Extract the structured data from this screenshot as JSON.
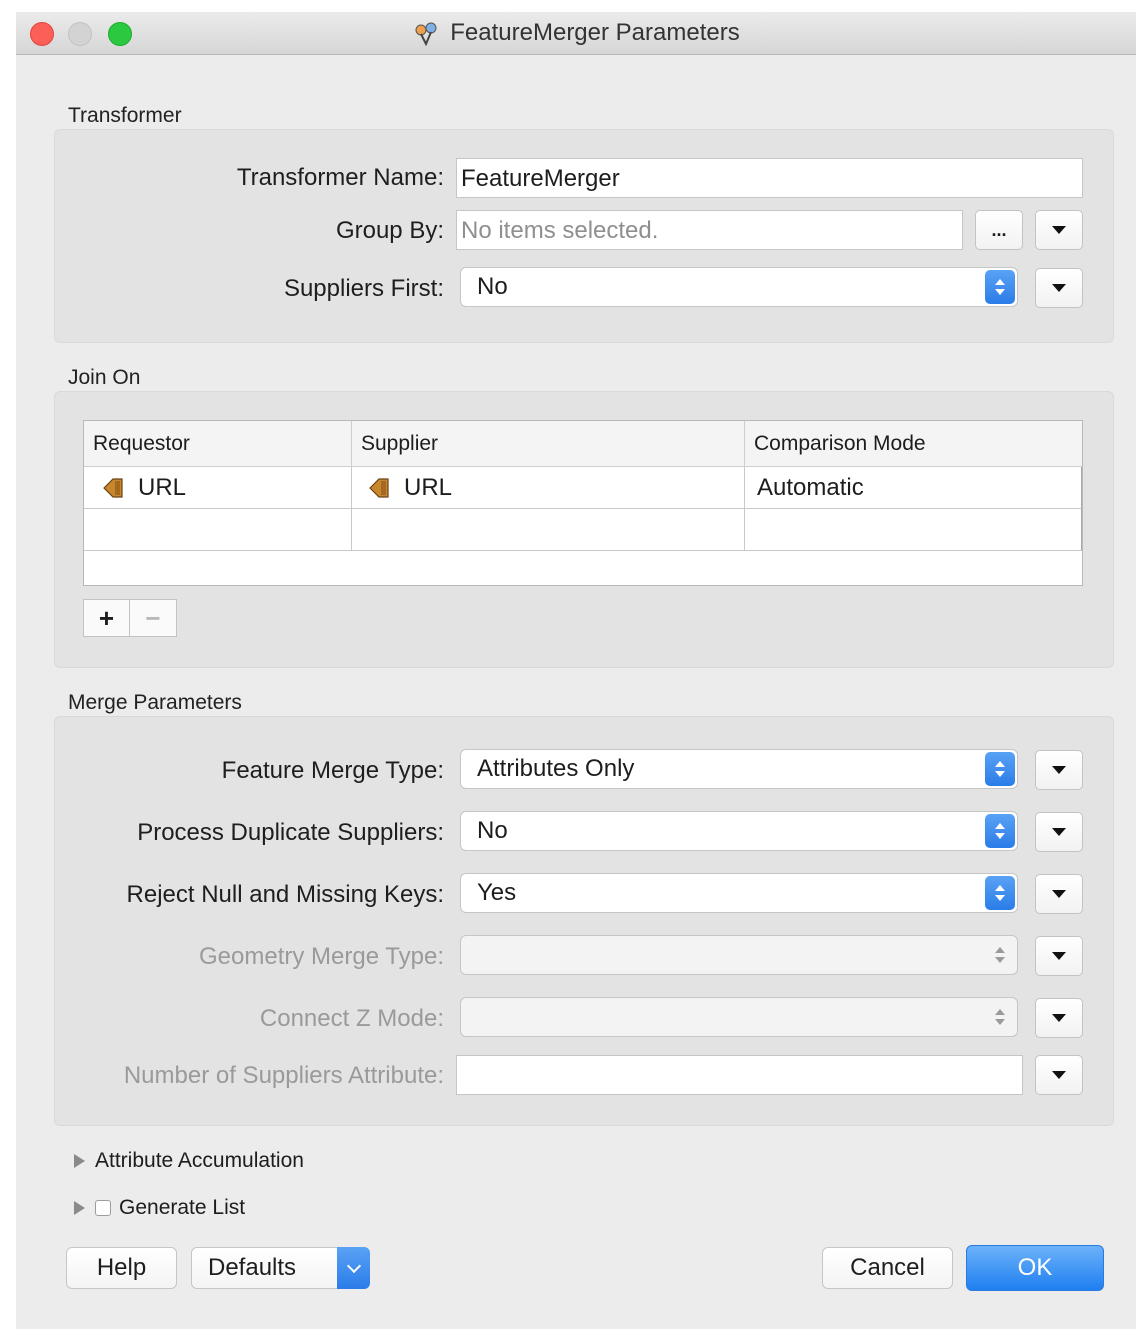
{
  "window": {
    "title": "FeatureMerger Parameters"
  },
  "transformer": {
    "section_label": "Transformer",
    "name_label": "Transformer Name:",
    "name_value": "FeatureMerger",
    "group_by_label": "Group By:",
    "group_by_placeholder": "No items selected.",
    "group_by_browse": "...",
    "suppliers_first_label": "Suppliers First:",
    "suppliers_first_value": "No"
  },
  "join_on": {
    "section_label": "Join On",
    "columns": [
      "Requestor",
      "Supplier",
      "Comparison Mode"
    ],
    "rows": [
      {
        "requestor": "URL",
        "supplier": "URL",
        "mode": "Automatic"
      }
    ],
    "add": "+",
    "remove": "−"
  },
  "merge": {
    "section_label": "Merge Parameters",
    "feature_merge_type_label": "Feature Merge Type:",
    "feature_merge_type_value": "Attributes Only",
    "process_duplicate_label": "Process Duplicate Suppliers:",
    "process_duplicate_value": "No",
    "reject_null_label": "Reject Null and Missing Keys:",
    "reject_null_value": "Yes",
    "geometry_merge_label": "Geometry Merge Type:",
    "connect_z_label": "Connect Z Mode:",
    "num_suppliers_label": "Number of Suppliers Attribute:"
  },
  "attribute_accumulation": "Attribute Accumulation",
  "generate_list": "Generate List",
  "buttons": {
    "help": "Help",
    "defaults": "Defaults",
    "cancel": "Cancel",
    "ok": "OK"
  },
  "colors": {
    "accent": "#2a7ce8",
    "attribute_icon": "#c8862e"
  }
}
